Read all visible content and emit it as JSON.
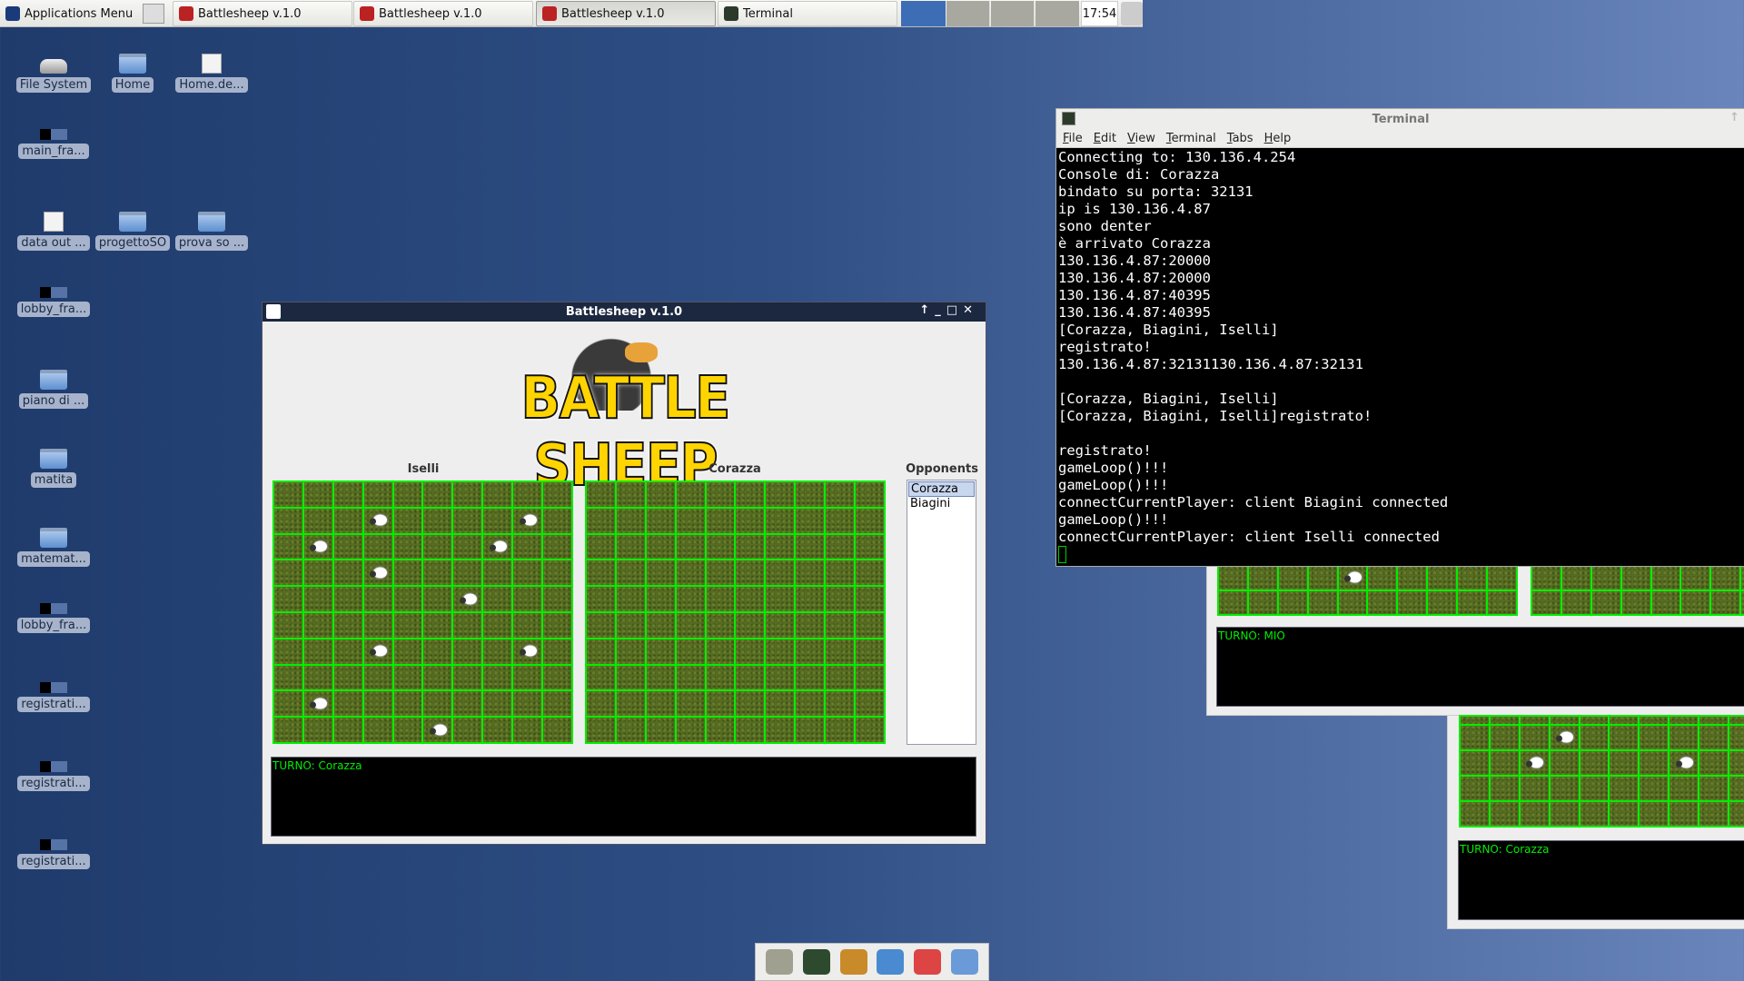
{
  "taskbar": {
    "app_menu": "Applications Menu",
    "tasks": [
      {
        "label": "Battlesheep v.1.0",
        "active": false
      },
      {
        "label": "Battlesheep v.1.0",
        "active": false
      },
      {
        "label": "Battlesheep v.1.0",
        "active": true
      },
      {
        "label": "Terminal",
        "active": false
      }
    ],
    "clock": "17:54"
  },
  "desktop_icons": [
    {
      "label": "File System",
      "icon": "drive-icon"
    },
    {
      "label": "Home",
      "icon": "home-folder-icon"
    },
    {
      "label": "Home.de...",
      "icon": "document-icon"
    },
    {
      "label": "main_fra...",
      "icon": "image-thumbnail-icon"
    },
    {
      "label": "data out ...",
      "icon": "text-file-icon"
    },
    {
      "label": "progettoSO",
      "icon": "folder-icon"
    },
    {
      "label": "prova so ...",
      "icon": "folder-icon"
    },
    {
      "label": "lobby_fra...",
      "icon": "image-thumbnail-icon"
    },
    {
      "label": "piano di ...",
      "icon": "folder-icon"
    },
    {
      "label": "matita",
      "icon": "folder-icon"
    },
    {
      "label": "matemat...",
      "icon": "folder-icon"
    },
    {
      "label": "lobby_fra...",
      "icon": "image-thumbnail-icon"
    },
    {
      "label": "registrati...",
      "icon": "image-thumbnail-icon"
    },
    {
      "label": "registrati...",
      "icon": "image-thumbnail-icon"
    },
    {
      "label": "registrati...",
      "icon": "image-thumbnail-icon"
    }
  ],
  "battlesheep": {
    "title": "Battlesheep v.1.0",
    "logo_text": "BATTLE SHEEP",
    "own_board_label": "Iselli",
    "opponent_board_label": "Corazza",
    "opponents_label": "Opponents",
    "opponents": [
      "Corazza",
      "Biagini"
    ],
    "selected_opponent": "Corazza",
    "own_sheep": [
      [
        1,
        3
      ],
      [
        1,
        8
      ],
      [
        2,
        1
      ],
      [
        2,
        7
      ],
      [
        3,
        3
      ],
      [
        4,
        6
      ],
      [
        6,
        3
      ],
      [
        6,
        8
      ],
      [
        8,
        1
      ],
      [
        9,
        5
      ]
    ],
    "log": "TURNO: Corazza",
    "grid_color": "#00ee00",
    "log_color": "#00ee00"
  },
  "terminal": {
    "title": "Terminal",
    "menu": [
      "File",
      "Edit",
      "View",
      "Terminal",
      "Tabs",
      "Help"
    ],
    "lines": [
      "Connecting to: 130.136.4.254",
      "Console di: Corazza",
      "bindato su porta: 32131",
      "ip is 130.136.4.87",
      "sono denter",
      "è arrivato Corazza",
      "130.136.4.87:20000",
      "130.136.4.87:20000",
      "130.136.4.87:40395",
      "130.136.4.87:40395",
      "[Corazza, Biagini, Iselli]",
      "registrato!",
      "130.136.4.87:32131130.136.4.87:32131",
      "",
      "[Corazza, Biagini, Iselli]",
      "[Corazza, Biagini, Iselli]registrato!",
      "",
      "registrato!",
      "gameLoop()!!!",
      "gameLoop()!!!",
      "connectCurrentPlayer: client Biagini connected",
      "gameLoop()!!!",
      "connectCurrentPlayer: client Iselli connected"
    ]
  },
  "background_windows": [
    {
      "log": "TURNO: MIO",
      "sheep_top_row": [
        4
      ]
    },
    {
      "log": "TURNO: Corazza",
      "sheep": [
        [
          0,
          3
        ],
        [
          1,
          2
        ],
        [
          1,
          7
        ]
      ]
    }
  ],
  "dock": [
    "drive-icon",
    "terminal-icon",
    "file-cabinet-icon",
    "web-browser-icon",
    "search-icon",
    "folder-icon"
  ]
}
